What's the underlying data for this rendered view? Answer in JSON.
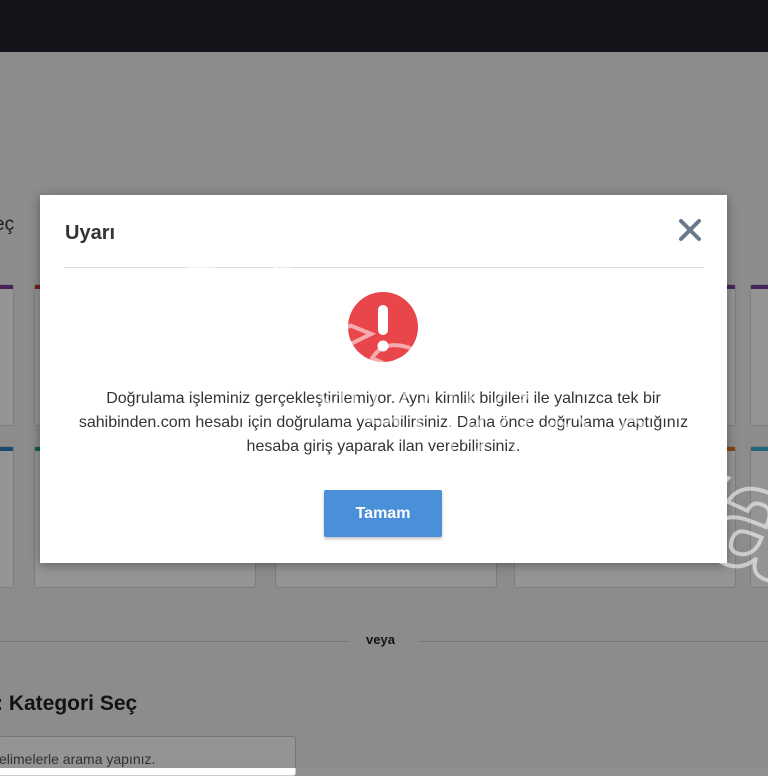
{
  "background": {
    "heading_fragment": "eç",
    "or_divider": "veya",
    "section_title": ": Kategori Seç",
    "search_placeholder": "elimelerle arama yapınız.",
    "card_stripe_colors": [
      "#7b3fa0",
      "#d0342c",
      "#2f7fc1",
      "#2aa198",
      "#e07b2a",
      "#3fb0d9"
    ]
  },
  "modal": {
    "title": "Uyarı",
    "message": "Doğrulama işleminiz gerçekleştirilemiyor. Aynı kimlik bilgileri ile yalnızca tek bir sahibinden.com hesabı için doğrulama yapabilirsiniz. Daha önce doğrulama yaptığınız hesaba giriş yaparak ilan verebilirsiniz.",
    "ok_label": "Tamam",
    "icons": {
      "close": "close-icon",
      "alert": "exclamation-icon"
    },
    "colors": {
      "alert": "#e9464b",
      "button": "#4a90d9",
      "close": "#6a7a8c"
    }
  },
  "watermark": {
    "text": "şikayetvar"
  }
}
